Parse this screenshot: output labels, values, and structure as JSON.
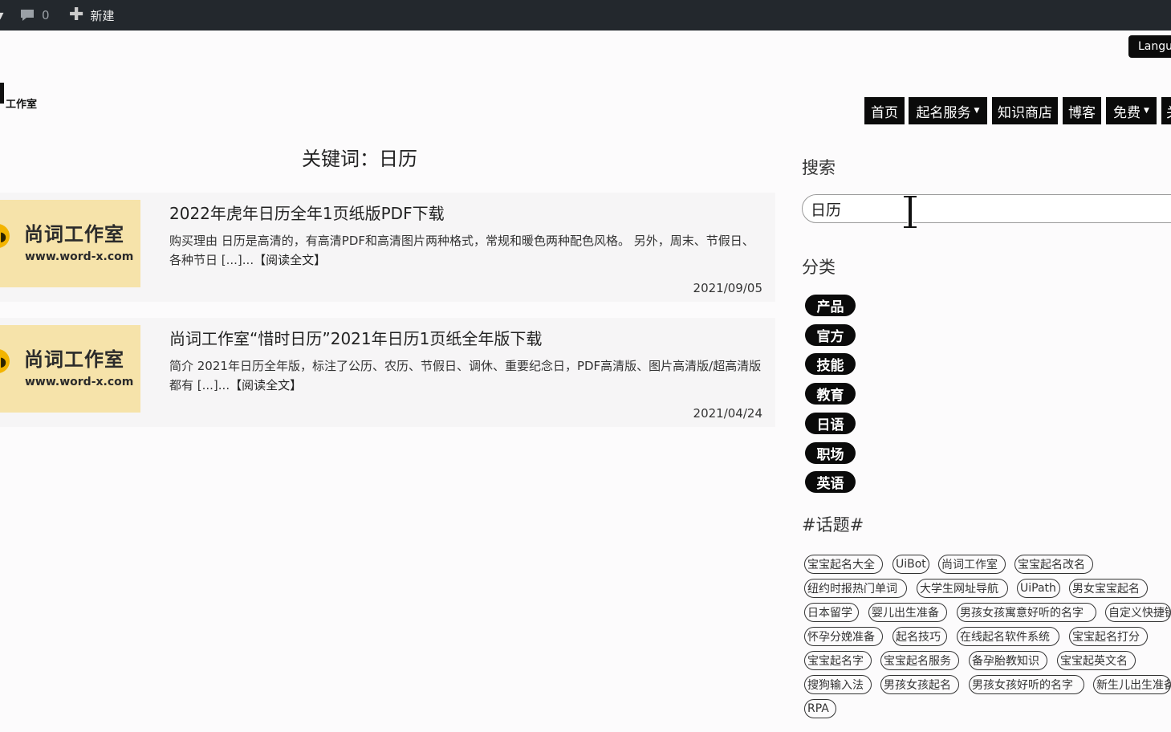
{
  "admin_bar": {
    "comment_count": "0",
    "new_label": "新建"
  },
  "language_button": "Langu",
  "logo": {
    "text": "工作室"
  },
  "nav": {
    "items": [
      "首页",
      "起名服务",
      "知识商店",
      "博客",
      "免费",
      "关"
    ]
  },
  "page_heading": "关键词：日历",
  "posts": [
    {
      "thumb_brand": "尚词工作室",
      "thumb_url": "www.word-x.com",
      "title": "2022年虎年日历全年1页纸版PDF下载",
      "excerpt": "购买理由 日历是高清的，有高清PDF和高清图片两种格式，常规和暖色两种配色风格。 另外，周末、节假日、各种节日 [...]...",
      "read_more": "【阅读全文】",
      "date": "2021/09/05"
    },
    {
      "thumb_brand": "尚词工作室",
      "thumb_url": "www.word-x.com",
      "title": "尚词工作室“惜时日历”2021年日历1页纸全年版下载",
      "excerpt": "简介 2021年日历全年版，标注了公历、农历、节假日、调休、重要纪念日，PDF高清版、图片高清版/超高清版都有 [...]...",
      "read_more": "【阅读全文】",
      "date": "2021/04/24"
    }
  ],
  "sidebar": {
    "search_heading": "搜索",
    "search_value": "日历",
    "categories_heading": "分类",
    "categories": [
      "产品",
      "官方",
      "技能",
      "教育",
      "日语",
      "职场",
      "英语"
    ],
    "topics_heading": "#话题#",
    "tags": [
      "宝宝起名大全",
      "UiBot",
      "尚词工作室",
      "宝宝起名改名",
      "纽约时报热门单词",
      "大学生网址导航",
      "UiPath",
      "男女宝宝起名",
      "日本留学",
      "婴儿出生准备",
      "男孩女孩寓意好听的名字",
      "自定义快捷键",
      "怀孕分娩准备",
      "起名技巧",
      "在线起名软件系统",
      "宝宝起名打分",
      "宝宝起名字",
      "宝宝起名服务",
      "备孕胎教知识",
      "宝宝起英文名",
      "搜狗输入法",
      "男孩女孩起名",
      "男孩女孩好听的名字",
      "新生儿出生准备",
      "RPA"
    ]
  }
}
